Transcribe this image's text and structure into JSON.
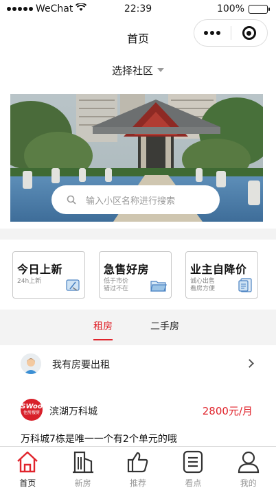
{
  "status_bar": {
    "carrier": "WeChat",
    "time": "22:39",
    "battery": "100%"
  },
  "navbar": {
    "title": "首页"
  },
  "community_selector": {
    "label": "选择社区"
  },
  "search": {
    "placeholder": "输入小区名称进行搜索"
  },
  "categories": [
    {
      "title": "今日上新",
      "subtitle": [
        "24h上新"
      ],
      "icon": "camera-icon"
    },
    {
      "title": "急售好房",
      "subtitle": [
        "低于市价",
        "错过不在"
      ],
      "icon": "folder-icon"
    },
    {
      "title": "业主自降价",
      "subtitle": [
        "诚心出售",
        "看房方便"
      ],
      "icon": "document-icon"
    }
  ],
  "tabs": [
    {
      "label": "租房",
      "active": true
    },
    {
      "label": "二手房",
      "active": false
    }
  ],
  "rent_entry": {
    "label": "我有房要出租"
  },
  "listing": {
    "logo_text": "SWoo",
    "logo_subtext": "住房搜房",
    "name": "滨湖万科城",
    "price": "2800元/月",
    "description": "万科城7栋是唯一一个有2个单元的哦"
  },
  "tabbar": [
    {
      "label": "首页",
      "icon": "home-icon",
      "active": true
    },
    {
      "label": "新房",
      "icon": "building-icon",
      "active": false
    },
    {
      "label": "推荐",
      "icon": "thumbs-up-icon",
      "active": false
    },
    {
      "label": "看点",
      "icon": "list-icon",
      "active": false
    },
    {
      "label": "我的",
      "icon": "user-icon",
      "active": false
    }
  ],
  "colors": {
    "accent": "#e0242c",
    "inactive": "#9a9a9a",
    "background": "#f3f3f3"
  }
}
